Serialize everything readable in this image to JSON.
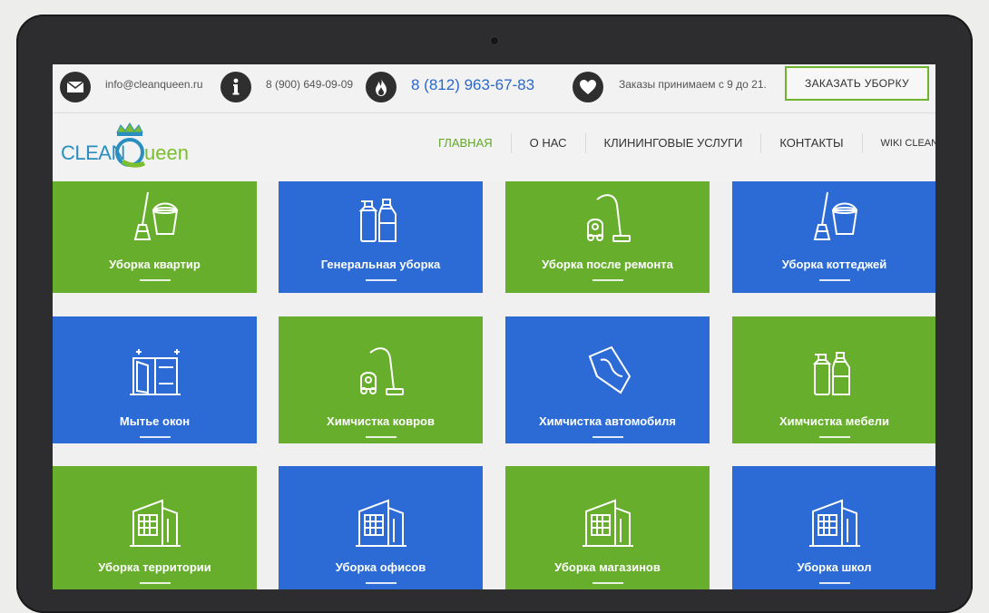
{
  "topbar": {
    "email": "info@cleanqueen.ru",
    "phone1": "8 (900) 649-09-09",
    "phone2": "8 (812) 963-67-83",
    "hours": "Заказы принимаем с 9 до 21.",
    "order_button": "ЗАКАЗАТЬ УБОРКУ",
    "icons": [
      "mail-icon",
      "info-icon",
      "fire-icon",
      "heart-icon"
    ]
  },
  "header": {
    "logo_text_clean": "CLEAN",
    "logo_text_queen": "ueen",
    "logo_letter_q": "Q",
    "nav": [
      {
        "label": "ГЛАВНАЯ",
        "active": true
      },
      {
        "label": "О НАС"
      },
      {
        "label": "КЛИНИНГОВЫЕ УСЛУГИ"
      },
      {
        "label": "КОНТАКТЫ"
      },
      {
        "label": "WIKI CLEANING"
      }
    ]
  },
  "colors": {
    "green": "#66ae2b",
    "blue": "#2c6bd6",
    "phone_blue": "#2a69c9",
    "nav_active": "#62a82b"
  },
  "tiles": [
    {
      "label": "Уборка квартир",
      "color": "green",
      "icon": "mop-bucket-icon"
    },
    {
      "label": "Генеральная уборка",
      "color": "blue",
      "icon": "detergent-bottles-icon"
    },
    {
      "label": "Уборка после ремонта",
      "color": "green",
      "icon": "vacuum-cleaner-icon"
    },
    {
      "label": "Уборка коттеджей",
      "color": "blue",
      "icon": "mop-bucket-icon"
    },
    {
      "label": "Мытье окон",
      "color": "blue",
      "icon": "window-icon"
    },
    {
      "label": "Химчистка ковров",
      "color": "green",
      "icon": "vacuum-cleaner-icon"
    },
    {
      "label": "Химчистка автомобиля",
      "color": "blue",
      "icon": "cleaning-cloth-icon"
    },
    {
      "label": "Химчистка мебели",
      "color": "green",
      "icon": "detergent-bottles-icon"
    },
    {
      "label": "Уборка территории",
      "color": "green",
      "icon": "building-icon"
    },
    {
      "label": "Уборка офисов",
      "color": "blue",
      "icon": "building-icon"
    },
    {
      "label": "Уборка магазинов",
      "color": "green",
      "icon": "building-icon"
    },
    {
      "label": "Уборка школ",
      "color": "blue",
      "icon": "building-icon"
    }
  ]
}
